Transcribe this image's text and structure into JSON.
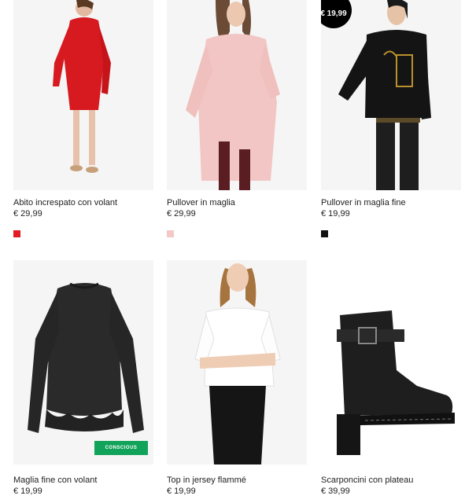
{
  "products": [
    {
      "name": "Abito increspato con volant",
      "price": "€ 29,99",
      "swatch": "#e31b23"
    },
    {
      "name": "Pullover in maglia",
      "price": "€ 29,99",
      "swatch": "#f3c9c7"
    },
    {
      "name": "Pullover in maglia fine",
      "price": "€ 19,99",
      "swatch": "#111111",
      "badge": "€ 19,99"
    },
    {
      "name": "Maglia fine con volant",
      "price": "€ 19,99",
      "label": "CONSCIOUS"
    },
    {
      "name": "Top in jersey flammé",
      "price": "€ 19,99"
    },
    {
      "name": "Scarponcini con plateau",
      "price": "€ 39,99"
    }
  ]
}
